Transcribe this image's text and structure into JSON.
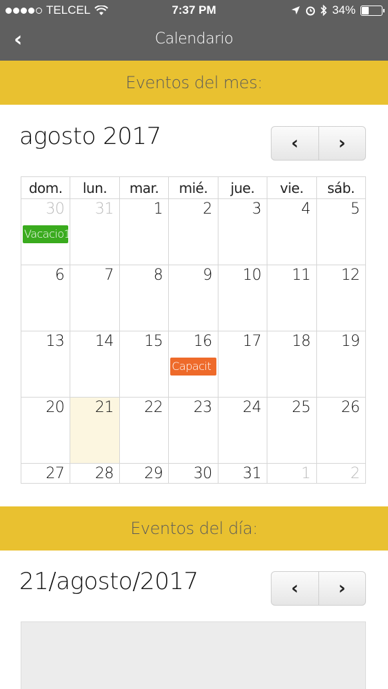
{
  "status": {
    "carrier": "TELCEL",
    "time": "7:37 PM",
    "battery": "34%"
  },
  "nav": {
    "back": "‹",
    "title": "Calendario"
  },
  "month_section": {
    "band": "Eventos del mes:",
    "heading": "agosto 2017",
    "prev": "‹",
    "next": "›",
    "weekdays": [
      "dom.",
      "lun.",
      "mar.",
      "mié.",
      "jue.",
      "vie.",
      "sáb."
    ],
    "weeks": [
      [
        {
          "d": "30",
          "other": true
        },
        {
          "d": "31",
          "other": true
        },
        {
          "d": "1"
        },
        {
          "d": "2"
        },
        {
          "d": "3"
        },
        {
          "d": "4"
        },
        {
          "d": "5"
        }
      ],
      [
        {
          "d": "6"
        },
        {
          "d": "7"
        },
        {
          "d": "8"
        },
        {
          "d": "9"
        },
        {
          "d": "10"
        },
        {
          "d": "11"
        },
        {
          "d": "12"
        }
      ],
      [
        {
          "d": "13"
        },
        {
          "d": "14"
        },
        {
          "d": "15"
        },
        {
          "d": "16"
        },
        {
          "d": "17"
        },
        {
          "d": "18"
        },
        {
          "d": "19"
        }
      ],
      [
        {
          "d": "20"
        },
        {
          "d": "21",
          "today": true
        },
        {
          "d": "22"
        },
        {
          "d": "23"
        },
        {
          "d": "24"
        },
        {
          "d": "25"
        },
        {
          "d": "26"
        }
      ],
      [
        {
          "d": "27"
        },
        {
          "d": "28"
        },
        {
          "d": "29"
        },
        {
          "d": "30"
        },
        {
          "d": "31"
        },
        {
          "d": "1",
          "other": true
        },
        {
          "d": "2",
          "other": true
        }
      ]
    ],
    "events": [
      {
        "week": 0,
        "day": 0,
        "label": "Vacacio1",
        "color": "#3aab1e"
      },
      {
        "week": 2,
        "day": 3,
        "label": "Capacit",
        "color": "#ee6a2a"
      }
    ]
  },
  "day_section": {
    "band": "Eventos del día:",
    "heading": "21/agosto/2017",
    "prev": "‹",
    "next": "›"
  },
  "colors": {
    "band": "#e9c130",
    "topbar": "#5f5f5f",
    "today": "#fcf6e0"
  }
}
